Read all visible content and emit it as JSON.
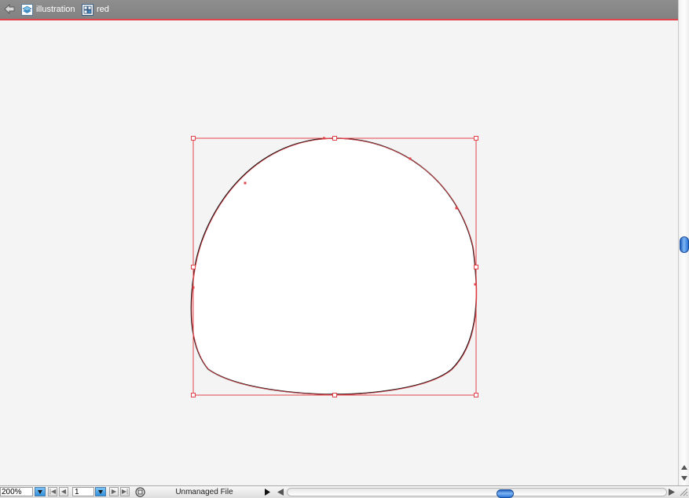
{
  "breadcrumb": {
    "items": [
      {
        "label": "illustration",
        "icon": "layer-icon"
      },
      {
        "label": "red",
        "icon": "group-icon"
      }
    ]
  },
  "statusbar": {
    "zoom": "200%",
    "page": "1",
    "status_text": "Unmanaged File"
  },
  "colors": {
    "selection": "#e0444a",
    "path": "#1a1a1a",
    "titlebar": "#888888",
    "scroll_thumb": "#2a73d8"
  }
}
